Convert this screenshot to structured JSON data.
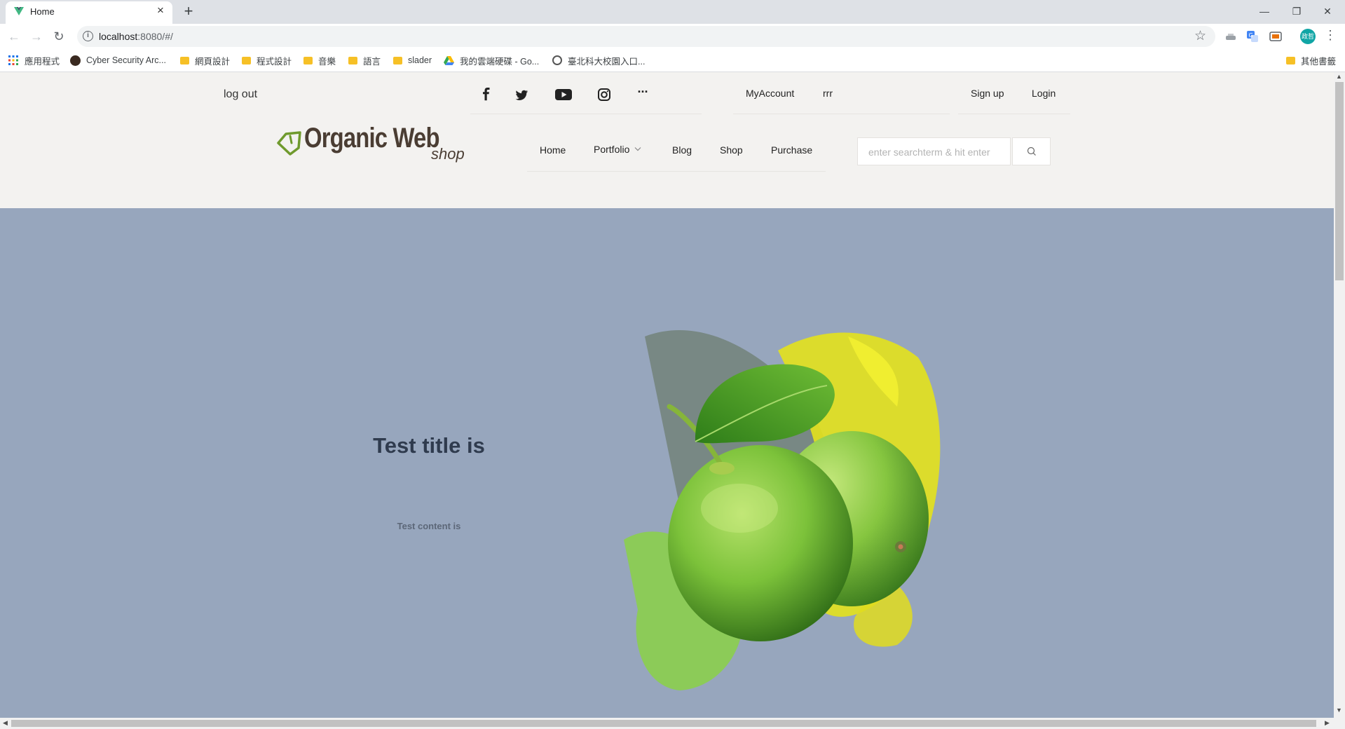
{
  "browser": {
    "tab_title": "Home",
    "tab_close": "×",
    "new_tab": "+",
    "url_host": "localhost",
    "url_rest": ":8080/#/",
    "window": {
      "minimize": "—",
      "restore": "❐",
      "close": "✕"
    },
    "profile_initials": "政哲"
  },
  "bookmarks": [
    {
      "label": "應用程式",
      "icon": "apps-grid-icon"
    },
    {
      "label": "Cyber Security Arc...",
      "icon": "site-icon"
    },
    {
      "label": "網頁設計",
      "icon": "folder-icon"
    },
    {
      "label": "程式設計",
      "icon": "folder-icon"
    },
    {
      "label": "音樂",
      "icon": "folder-icon"
    },
    {
      "label": "語言",
      "icon": "folder-icon"
    },
    {
      "label": "slader",
      "icon": "folder-icon"
    },
    {
      "label": "我的雲端硬碟 - Go...",
      "icon": "google-drive-icon"
    },
    {
      "label": "臺北科大校園入口...",
      "icon": "globe-icon"
    },
    {
      "label": "其他書籤",
      "icon": "folder-icon"
    }
  ],
  "header": {
    "logout": "log out",
    "social_more": "···",
    "account": {
      "my_account": "MyAccount",
      "username": "rrr"
    },
    "auth": {
      "signup": "Sign up",
      "login": "Login"
    },
    "logo": {
      "title": "Organic Web",
      "sub": "shop"
    },
    "nav": [
      "Home",
      "Portfolio",
      "Blog",
      "Shop",
      "Purchase"
    ],
    "search": {
      "placeholder": "enter searchterm & hit enter",
      "value": ""
    }
  },
  "hero": {
    "title": "Test title is",
    "content": "Test content is"
  },
  "colors": {
    "hero_bg": "#97a6bd",
    "page_bg": "#f3f2f0",
    "logo_green": "#6f9a2d",
    "logo_brown": "#4a3d33"
  }
}
